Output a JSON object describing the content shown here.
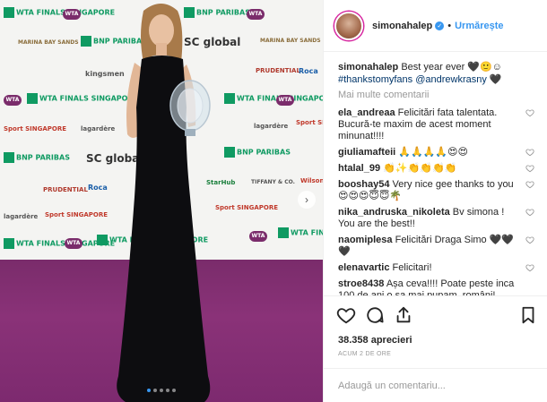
{
  "post": {
    "author": "simonahalep",
    "follow_label": "Urmărește",
    "separator": "•",
    "caption_text": "Best year ever 🖤🙂☺",
    "caption_tags": "#thankstomyfans @andrewkrasny",
    "caption_tail": "🖤",
    "more_comments_label": "Mai multe comentarii",
    "likes": "38.358 aprecieri",
    "time_ago": "ACUM 2 DE ORE",
    "add_comment_placeholder": "Adaugă un comentariu..."
  },
  "comments": [
    {
      "user": "ela_andreaa",
      "text": "Felicitări fata talentata. Bucură-te maxim de acest moment minunat!!!!"
    },
    {
      "user": "giuliamafteii",
      "text": "🙏🙏🙏🙏😍😍"
    },
    {
      "user": "htalal_99",
      "text": "👏✨👏👏👏👏"
    },
    {
      "user": "booshay54",
      "text": "Very nice gee thanks to you 😍😍😍😇😇🌴"
    },
    {
      "user": "nika_andruska_nikoleta",
      "text": "Bv simona ! You are the best!!"
    },
    {
      "user": "naomiplesa",
      "text": "Felicitări Draga Simo 🖤🖤🖤"
    },
    {
      "user": "elenavartic",
      "text": "Felicitari!"
    },
    {
      "user": "stroe8438",
      "text": "Așa ceva!!!! Poate peste inca 100 de ani o sa mai pupam, români!"
    }
  ],
  "backdrop_logos": [
    {
      "text": "BNP PARIBAS"
    },
    {
      "text": "SC global"
    },
    {
      "text": "WTA FINALS SINGAPORE"
    },
    {
      "text": "kingsmen"
    },
    {
      "text": "Roca"
    },
    {
      "text": "Sport SINGAPORE"
    },
    {
      "text": "lagardère"
    },
    {
      "text": "StarHub"
    },
    {
      "text": "TIFFANY & CO."
    },
    {
      "text": "Wilson"
    },
    {
      "text": "PRUDENTIAL"
    },
    {
      "text": "MARINA BAY SANDS"
    }
  ],
  "colors": {
    "accent": "#3897f0",
    "carpet": "#7d2a6f",
    "text": "#262626",
    "muted": "#999999",
    "bnp_green": "#0f9a62"
  },
  "icons": {
    "verified": "verified-badge-icon",
    "like": "heart-icon",
    "comment": "comment-bubble-icon",
    "share": "share-icon",
    "save": "bookmark-icon",
    "next": "chevron-right-icon"
  },
  "carousel": {
    "count": 5,
    "active": 1
  }
}
